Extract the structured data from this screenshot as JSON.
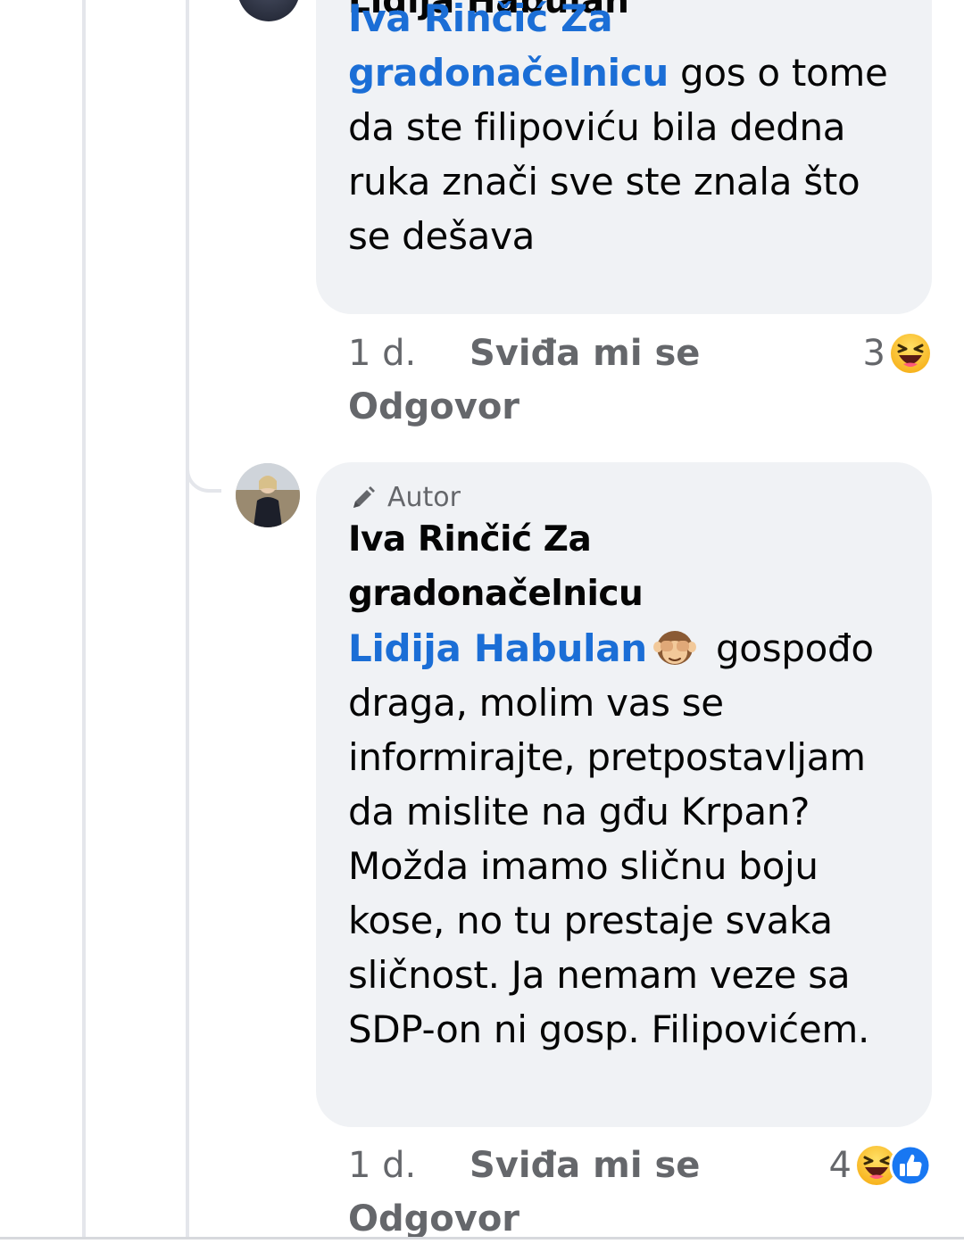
{
  "comments": [
    {
      "author": "Lidija Habulan",
      "mention": "Iva Rinčić Za gradonačelnicu",
      "text": " gos o tome da ste filipoviću bila dedna ruka znači sve ste znala što se dešava",
      "time": "1 d.",
      "like_label": "Sviđa mi se",
      "reply_label": "Odgovor",
      "reaction_count": "3",
      "reactions": [
        "haha"
      ]
    },
    {
      "badge": "Autor",
      "author": "Iva Rinčić Za gradonačelnicu",
      "mention": "Lidija Habulan",
      "text": " gospođo draga, molim vas se informirajte, pretpostavljam da mislite na gđu Krpan? Možda imamo sličnu boju kose, no tu prestaje svaka sličnost. Ja nemam veze sa SDP-on ni gosp. Filipovićem.",
      "time": "1 d.",
      "like_label": "Sviđa mi se",
      "reply_label": "Odgovor",
      "reaction_count": "4",
      "reactions": [
        "haha",
        "like"
      ]
    }
  ],
  "colors": {
    "mention": "#1b6ed6",
    "bubble": "#f0f2f5",
    "meta_text": "#65676b",
    "body_text": "#050505"
  }
}
